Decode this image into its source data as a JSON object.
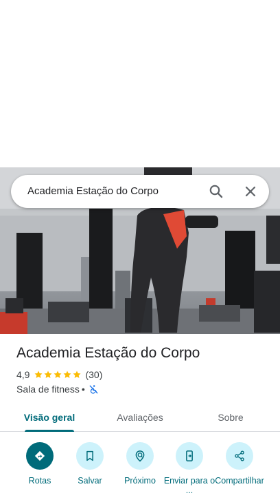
{
  "search": {
    "query": "Academia Estação do Corpo",
    "search_icon": "search-icon",
    "close_icon": "close-icon"
  },
  "photo": {
    "subject": "gym-interior-photo"
  },
  "place": {
    "title": "Academia Estação do Corpo",
    "rating": "4,9",
    "stars": 5,
    "reviews": "(30)",
    "category": "Sala de fitness",
    "separator": "•",
    "accessibility_icon": "not-wheelchair-accessible-icon"
  },
  "tabs": [
    {
      "label": "Visão geral",
      "active": true
    },
    {
      "label": "Avaliações",
      "active": false
    },
    {
      "label": "Sobre",
      "active": false
    }
  ],
  "actions": [
    {
      "label": "Rotas",
      "icon": "directions-icon"
    },
    {
      "label": "Salvar",
      "icon": "bookmark-icon"
    },
    {
      "label": "Próximo",
      "icon": "nearby-icon"
    },
    {
      "label": "Enviar para o ...",
      "icon": "send-to-phone-icon"
    },
    {
      "label": "Compartilhar",
      "icon": "share-icon"
    }
  ],
  "colors": {
    "accent": "#006b7a",
    "accent_light": "#cdf2fb",
    "star": "#fbbc04",
    "text": "#202124",
    "secondary_text": "#3c4043"
  }
}
